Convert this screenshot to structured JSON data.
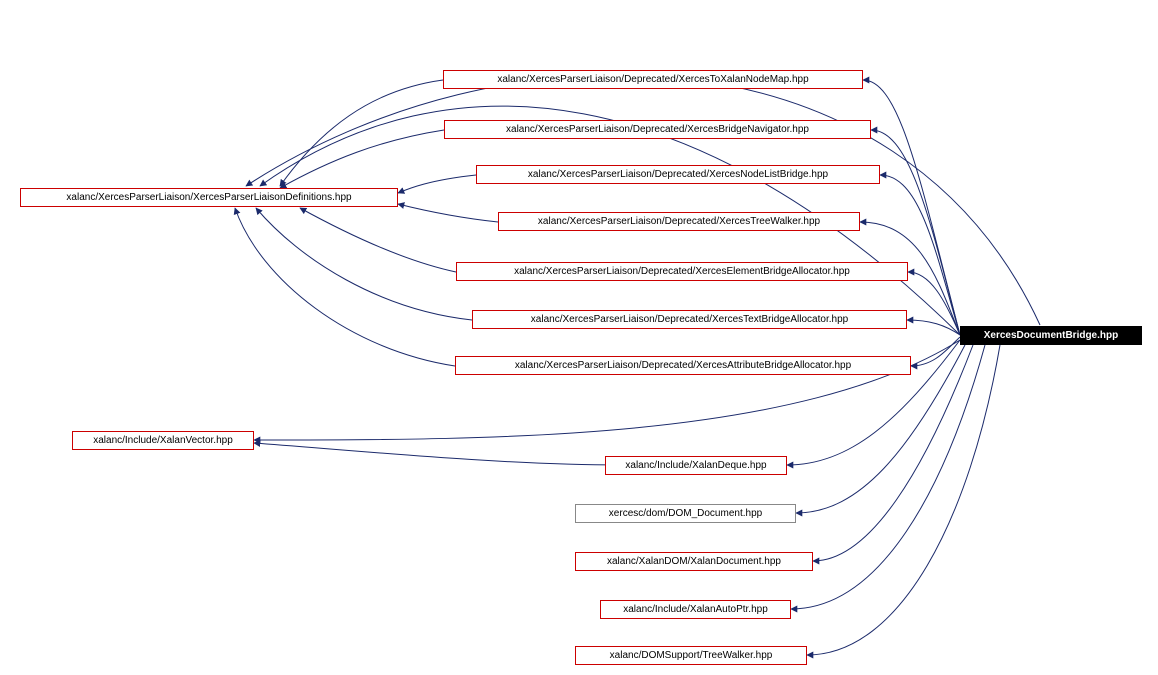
{
  "diagram": {
    "root_label": "XercesDocumentBridge.hpp",
    "defs_label": "xalanc/XercesParserLiaison/XercesParserLiaisonDefinitions.hpp",
    "tonodemap_label": "xalanc/XercesParserLiaison/Deprecated/XercesToXalanNodeMap.hpp",
    "bridgenav_label": "xalanc/XercesParserLiaison/Deprecated/XercesBridgeNavigator.hpp",
    "nodelist_label": "xalanc/XercesParserLiaison/Deprecated/XercesNodeListBridge.hpp",
    "treewalker_label": "xalanc/XercesParserLiaison/Deprecated/XercesTreeWalker.hpp",
    "elemalloc_label": "xalanc/XercesParserLiaison/Deprecated/XercesElementBridgeAllocator.hpp",
    "textalloc_label": "xalanc/XercesParserLiaison/Deprecated/XercesTextBridgeAllocator.hpp",
    "attralloc_label": "xalanc/XercesParserLiaison/Deprecated/XercesAttributeBridgeAllocator.hpp",
    "vector_label": "xalanc/Include/XalanVector.hpp",
    "deque_label": "xalanc/Include/XalanDeque.hpp",
    "domdoc_label": "xercesc/dom/DOM_Document.hpp",
    "xalandoc_label": "xalanc/XalanDOM/XalanDocument.hpp",
    "autoptr_label": "xalanc/Include/XalanAutoPtr.hpp",
    "domsupport_label": "xalanc/DOMSupport/TreeWalker.hpp"
  }
}
